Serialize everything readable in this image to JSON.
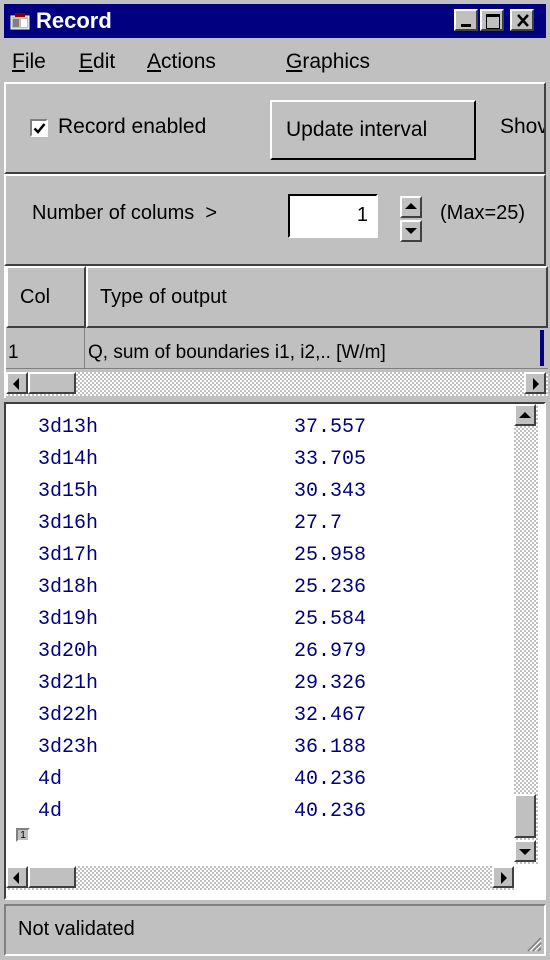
{
  "window": {
    "title": "Record"
  },
  "menu": [
    {
      "label": "File",
      "hotkey": "F",
      "rest": "ile"
    },
    {
      "label": "Edit",
      "hotkey": "E",
      "rest": "dit"
    },
    {
      "label": "Actions",
      "hotkey": "A",
      "rest": "ctions"
    },
    {
      "label": "Graphics",
      "hotkey": "G",
      "rest": "raphics"
    }
  ],
  "toolbar": {
    "record_enabled_label": "Record enabled",
    "record_enabled_checked": true,
    "update_interval_label": "Update interval",
    "show_label": "Shov"
  },
  "columns": {
    "label": "Number of colums  >",
    "value": "1",
    "max_label": "(Max=25)"
  },
  "grid": {
    "headers": {
      "col": "Col",
      "type": "Type of output"
    },
    "rows": [
      {
        "col": "1",
        "type": "Q, sum of boundaries i1, i2,.. [W/m]"
      }
    ]
  },
  "data": [
    {
      "time": "3d13h",
      "value": "37.557"
    },
    {
      "time": "3d14h",
      "value": "33.705"
    },
    {
      "time": "3d15h",
      "value": "30.343"
    },
    {
      "time": "3d16h",
      "value": "27.7"
    },
    {
      "time": "3d17h",
      "value": "25.958"
    },
    {
      "time": "3d18h",
      "value": "25.236"
    },
    {
      "time": "3d19h",
      "value": "25.584"
    },
    {
      "time": "3d20h",
      "value": "26.979"
    },
    {
      "time": "3d21h",
      "value": "29.326"
    },
    {
      "time": "3d22h",
      "value": "32.467"
    },
    {
      "time": "3d23h",
      "value": "36.188"
    },
    {
      "time": "4d",
      "value": "40.236"
    },
    {
      "time": "4d",
      "value": "40.236"
    }
  ],
  "footer_marker": "1",
  "status": {
    "text": "Not validated"
  },
  "colors": {
    "title_bar": "#000080",
    "data_text": "#000080",
    "face": "#c0c0c0"
  }
}
